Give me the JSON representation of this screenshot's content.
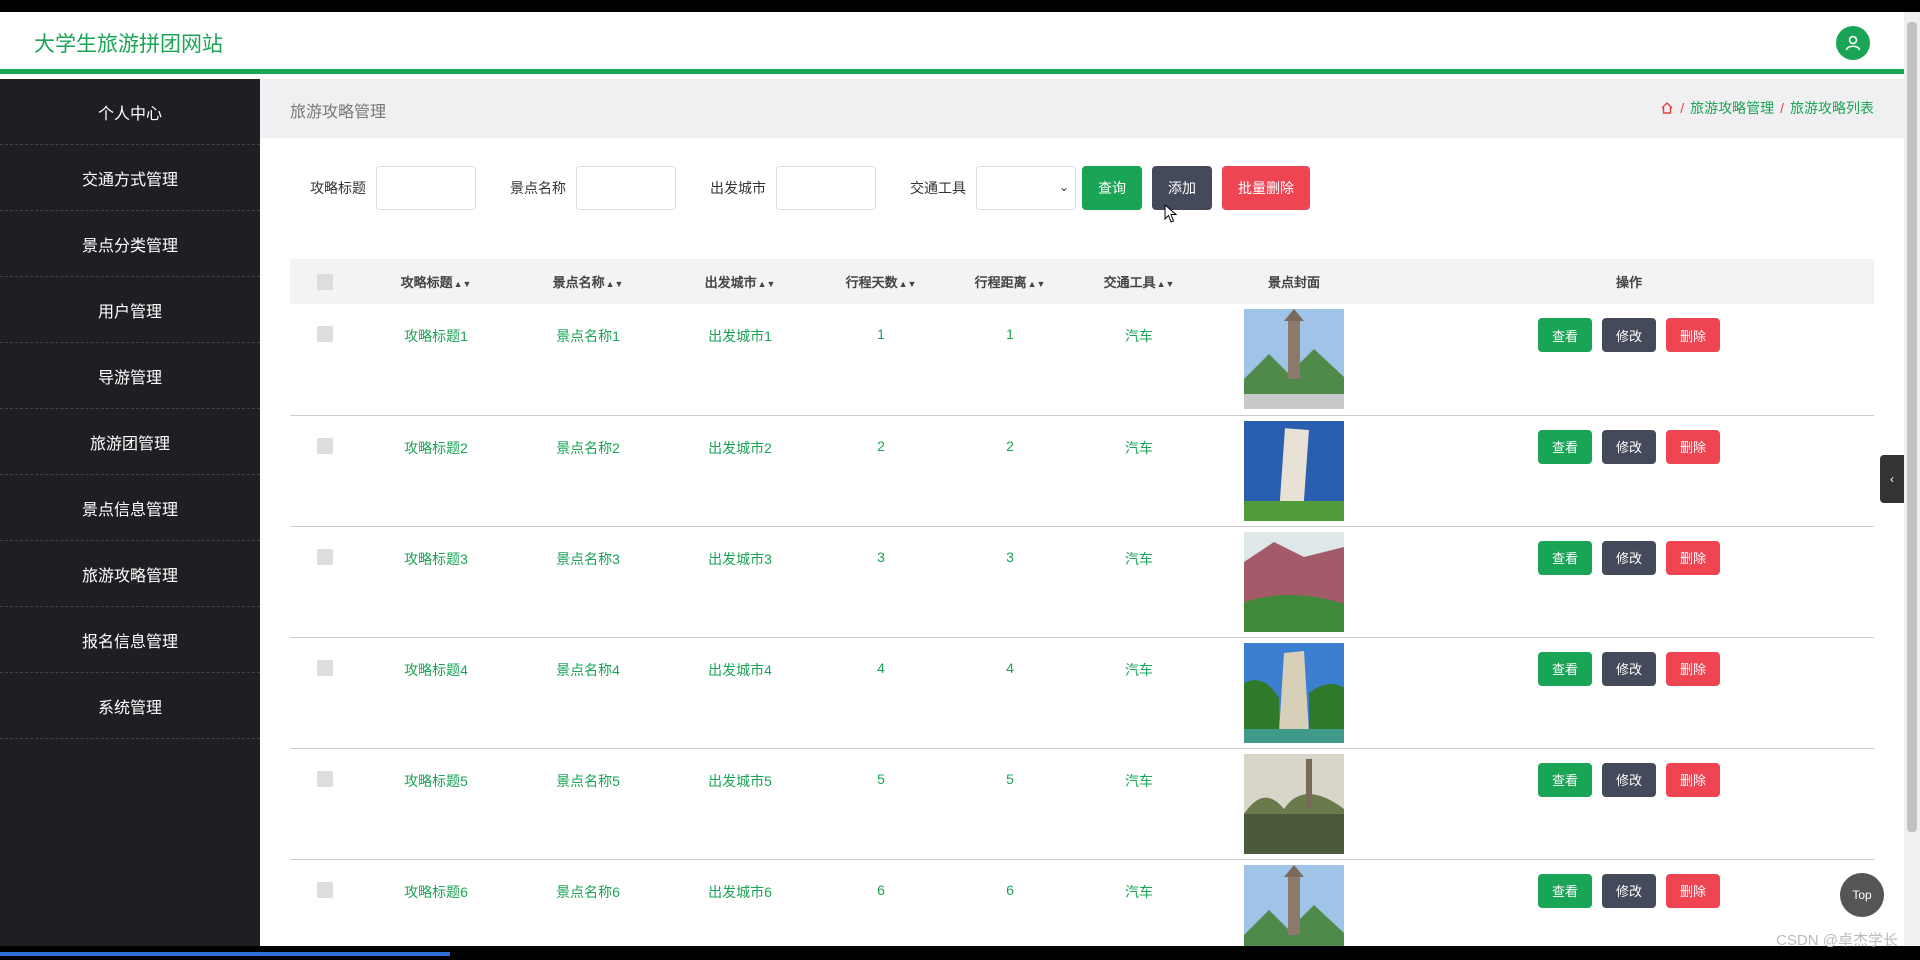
{
  "header": {
    "site_title": "大学生旅游拼团网站",
    "avatar_icon": "user-icon"
  },
  "sidebar": {
    "items": [
      {
        "label": "个人中心"
      },
      {
        "label": "交通方式管理"
      },
      {
        "label": "景点分类管理"
      },
      {
        "label": "用户管理"
      },
      {
        "label": "导游管理"
      },
      {
        "label": "旅游团管理"
      },
      {
        "label": "景点信息管理"
      },
      {
        "label": "旅游攻略管理"
      },
      {
        "label": "报名信息管理"
      },
      {
        "label": "系统管理"
      }
    ]
  },
  "page": {
    "title": "旅游攻略管理",
    "breadcrumb": [
      "旅游攻略管理",
      "旅游攻略列表"
    ]
  },
  "filters": {
    "strategy_title_label": "攻略标题",
    "scenic_name_label": "景点名称",
    "depart_city_label": "出发城市",
    "transport_label": "交通工具",
    "search_btn": "查询",
    "add_btn": "添加",
    "batch_delete_btn": "批量删除"
  },
  "table": {
    "headers": [
      "攻略标题",
      "景点名称",
      "出发城市",
      "行程天数",
      "行程距离",
      "交通工具",
      "景点封面",
      "操作"
    ],
    "rows": [
      {
        "title": "攻略标题1",
        "scenic": "景点名称1",
        "city": "出发城市1",
        "days": "1",
        "distance": "1",
        "transport": "汽车"
      },
      {
        "title": "攻略标题2",
        "scenic": "景点名称2",
        "city": "出发城市2",
        "days": "2",
        "distance": "2",
        "transport": "汽车"
      },
      {
        "title": "攻略标题3",
        "scenic": "景点名称3",
        "city": "出发城市3",
        "days": "3",
        "distance": "3",
        "transport": "汽车"
      },
      {
        "title": "攻略标题4",
        "scenic": "景点名称4",
        "city": "出发城市4",
        "days": "4",
        "distance": "4",
        "transport": "汽车"
      },
      {
        "title": "攻略标题5",
        "scenic": "景点名称5",
        "city": "出发城市5",
        "days": "5",
        "distance": "5",
        "transport": "汽车"
      },
      {
        "title": "攻略标题6",
        "scenic": "景点名称6",
        "city": "出发城市6",
        "days": "6",
        "distance": "6",
        "transport": "汽车"
      }
    ],
    "actions": {
      "view": "查看",
      "edit": "修改",
      "delete": "删除"
    }
  },
  "misc": {
    "top_btn": "Top",
    "watermark": "CSDN @卓杰学长"
  },
  "colors": {
    "accent": "#1aa455",
    "sidebar_bg": "#1f1f23",
    "danger": "#ef4452",
    "dark_btn": "#444a5a"
  }
}
